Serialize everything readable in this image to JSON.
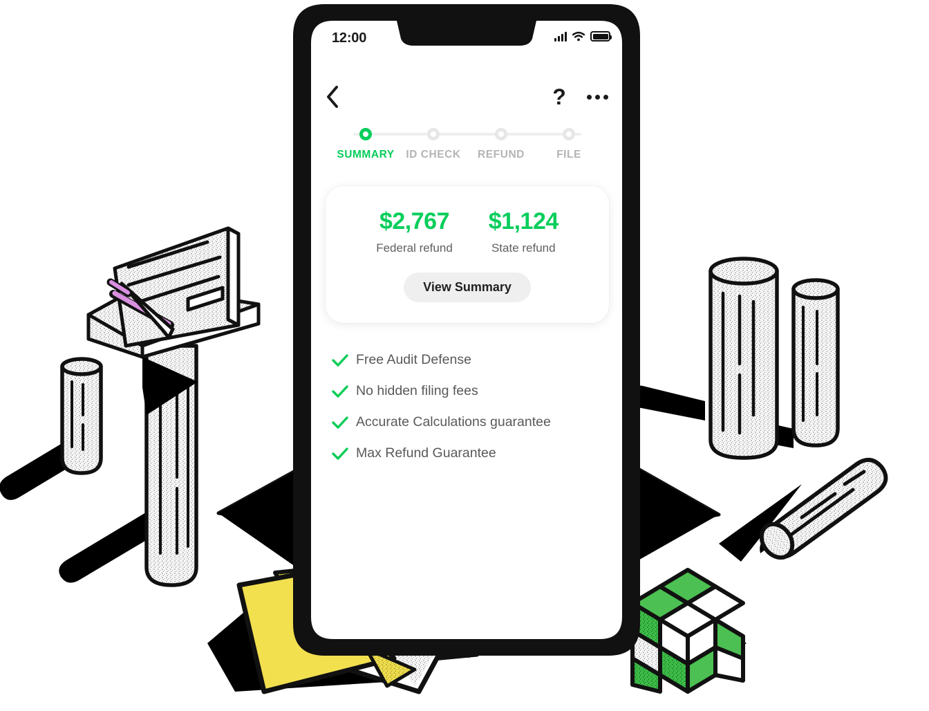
{
  "app": {
    "platform": "ios-phone-mockup",
    "accent_color": "#06CE5B",
    "status_bar": {
      "time": "12:00",
      "signal_icon": "cellular-signal-icon",
      "wifi_icon": "wifi-icon",
      "battery_icon": "battery-full-icon"
    },
    "navbar": {
      "back_icon": "chevron-left-icon",
      "help_label": "?",
      "more_icon": "overflow-menu-icon"
    },
    "stepper": {
      "steps": [
        {
          "label": "SUMMARY",
          "state": "active"
        },
        {
          "label": "ID CHECK",
          "state": "inactive"
        },
        {
          "label": "REFUND",
          "state": "inactive"
        },
        {
          "label": "FILE",
          "state": "inactive"
        }
      ]
    },
    "refund_card": {
      "items": [
        {
          "amount": "$2,767",
          "caption": "Federal refund"
        },
        {
          "amount": "$1,124",
          "caption": "State refund"
        }
      ],
      "button_label": "View Summary"
    },
    "features": [
      {
        "icon": "check-icon",
        "label": "Free Audit Defense"
      },
      {
        "icon": "check-icon",
        "label": "No hidden filing fees"
      },
      {
        "icon": "check-icon",
        "label": "Accurate Calculations guarantee"
      },
      {
        "icon": "check-icon",
        "label": "Max Refund Guarantee"
      }
    ]
  },
  "illustration": {
    "style": "hand-drawn isometric line art",
    "colors": {
      "ink": "#111111",
      "folder_yellow": "#F2E04F",
      "cube_green": "#4CC council",
      "pen_purple": "#D98FE0"
    },
    "objects": [
      "document-on-pedestal",
      "purple-pen",
      "stone-pillar-left-small",
      "stone-pillar-left-large",
      "stone-pillar-right-large",
      "stone-pillar-right-small",
      "fallen-log",
      "yellow-folder-with-papers",
      "green-white-cube-stack",
      "phone-pedestal"
    ]
  }
}
